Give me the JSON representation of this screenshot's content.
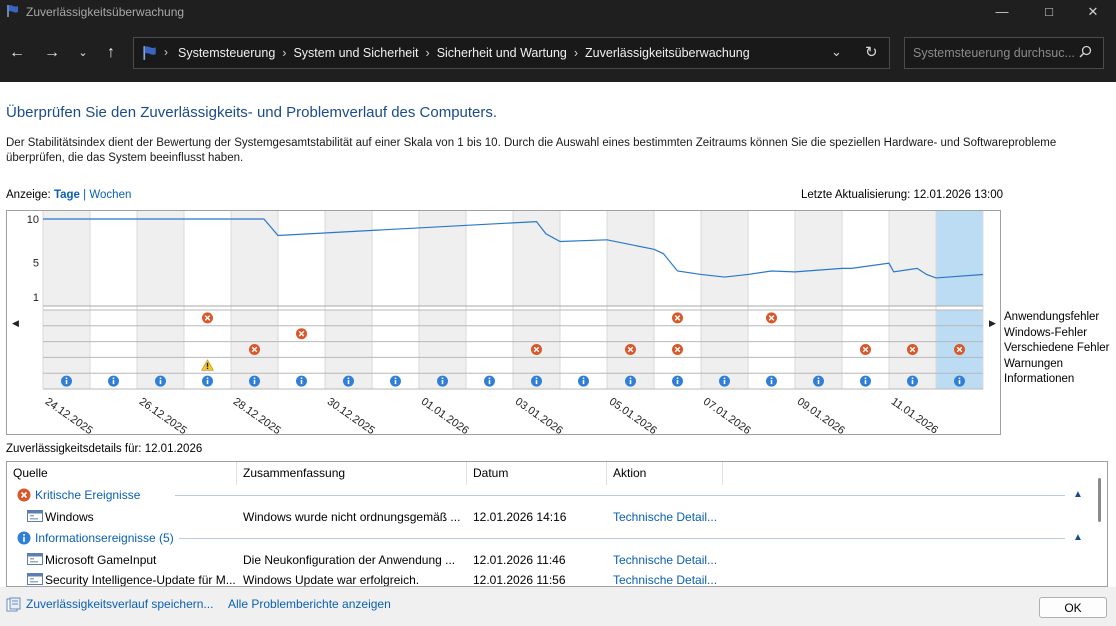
{
  "window": {
    "title": "Zuverlässigkeitsüberwachung"
  },
  "nav": {
    "breadcrumbs": [
      "Systemsteuerung",
      "System und Sicherheit",
      "Sicherheit und Wartung",
      "Zuverlässigkeitsüberwachung"
    ],
    "search_placeholder": "Systemsteuerung durchsuc..."
  },
  "page": {
    "heading": "Überprüfen Sie den Zuverlässigkeits- und Problemverlauf des Computers.",
    "description": "Der Stabilitätsindex dient der Bewertung der Systemgesamtstabilität auf einer Skala von 1 bis 10. Durch die Auswahl eines bestimmten Zeitraums können Sie die speziellen Hardware- und Softwareprobleme überprüfen, die das System beeinflusst haben.",
    "view_label": "Anzeige:",
    "view_days": "Tage",
    "view_sep": "|",
    "view_weeks": "Wochen",
    "last_update": "Letzte Aktualisierung: 12.01.2026 13:00"
  },
  "chart_data": {
    "type": "line",
    "title": "",
    "y_ticks": [
      "10",
      "5",
      "1"
    ],
    "ylim": [
      1,
      10
    ],
    "dates": [
      "24.12.2025",
      "25.12.2025",
      "26.12.2025",
      "27.12.2025",
      "28.12.2025",
      "29.12.2025",
      "30.12.2025",
      "31.12.2025",
      "01.01.2026",
      "02.01.2026",
      "03.01.2026",
      "04.01.2026",
      "05.01.2026",
      "06.01.2026",
      "07.01.2026",
      "08.01.2026",
      "09.01.2026",
      "10.01.2026",
      "11.01.2026",
      "12.01.2026"
    ],
    "x_tick_labels": [
      "24.12.2025",
      "26.12.2025",
      "28.12.2025",
      "30.12.2025",
      "01.01.2026",
      "03.01.2026",
      "05.01.2026",
      "07.01.2026",
      "09.01.2026",
      "11.01.2026"
    ],
    "selected_date": "12.01.2026",
    "stability_index": [
      [
        0,
        10
      ],
      [
        4.7,
        10
      ],
      [
        5,
        8.1
      ],
      [
        10.5,
        9.7
      ],
      [
        10.7,
        8.3
      ],
      [
        11,
        7.4
      ],
      [
        12,
        7.6
      ],
      [
        13,
        6.5
      ],
      [
        13.2,
        6.0
      ],
      [
        13.5,
        4.0
      ],
      [
        14,
        3.6
      ],
      [
        14.5,
        3.3
      ],
      [
        15,
        3.6
      ],
      [
        15.5,
        4.0
      ],
      [
        16,
        3.9
      ],
      [
        17,
        4.3
      ],
      [
        17.2,
        4.3
      ],
      [
        18,
        4.9
      ],
      [
        18.1,
        3.9
      ],
      [
        18.6,
        4.3
      ],
      [
        18.8,
        3.6
      ],
      [
        19,
        3.2
      ],
      [
        20,
        3.6
      ]
    ],
    "event_rows": [
      "Anwendungsfehler",
      "Windows-Fehler",
      "Verschiedene Fehler",
      "Warnungen",
      "Informationen"
    ],
    "events": {
      "Anwendungsfehler": [
        "27.12.2025",
        "06.01.2026",
        "08.01.2026"
      ],
      "Windows-Fehler": [
        "29.12.2025"
      ],
      "Verschiedene Fehler": [
        "28.12.2025",
        "03.01.2026",
        "05.01.2026",
        "06.01.2026",
        "10.01.2026",
        "11.01.2026",
        "12.01.2026"
      ],
      "Warnungen": [
        "27.12.2025"
      ],
      "Informationen": [
        "24.12.2025",
        "25.12.2025",
        "26.12.2025",
        "27.12.2025",
        "28.12.2025",
        "29.12.2025",
        "30.12.2025",
        "31.12.2025",
        "01.01.2026",
        "02.01.2026",
        "03.01.2026",
        "04.01.2026",
        "05.01.2026",
        "06.01.2026",
        "07.01.2026",
        "08.01.2026",
        "09.01.2026",
        "10.01.2026",
        "11.01.2026",
        "12.01.2026"
      ]
    },
    "grid": true
  },
  "details": {
    "label": "Zuverlässigkeitsdetails für: 12.01.2026",
    "columns": [
      "Quelle",
      "Zusammenfassung",
      "Datum",
      "Aktion"
    ],
    "groups": [
      {
        "title": "Kritische Ereignisse",
        "rows": [
          {
            "source": "Windows",
            "summary": "Windows wurde nicht ordnungsgemäß ...",
            "date": "12.01.2026 14:16",
            "action": "Technische Detail..."
          }
        ]
      },
      {
        "title": "Informationsereignisse (5)",
        "rows": [
          {
            "source": "Microsoft GameInput",
            "summary": "Die Neukonfiguration der Anwendung ...",
            "date": "12.01.2026 11:46",
            "action": "Technische Detail..."
          },
          {
            "source": "Security Intelligence-Update für M...",
            "summary": "Windows Update war erfolgreich.",
            "date": "12.01.2026 11:56",
            "action": "Technische Detail..."
          }
        ]
      }
    ]
  },
  "footer": {
    "save_link": "Zuverlässigkeitsverlauf speichern...",
    "reports_link": "Alle Problemberichte anzeigen",
    "ok": "OK"
  }
}
